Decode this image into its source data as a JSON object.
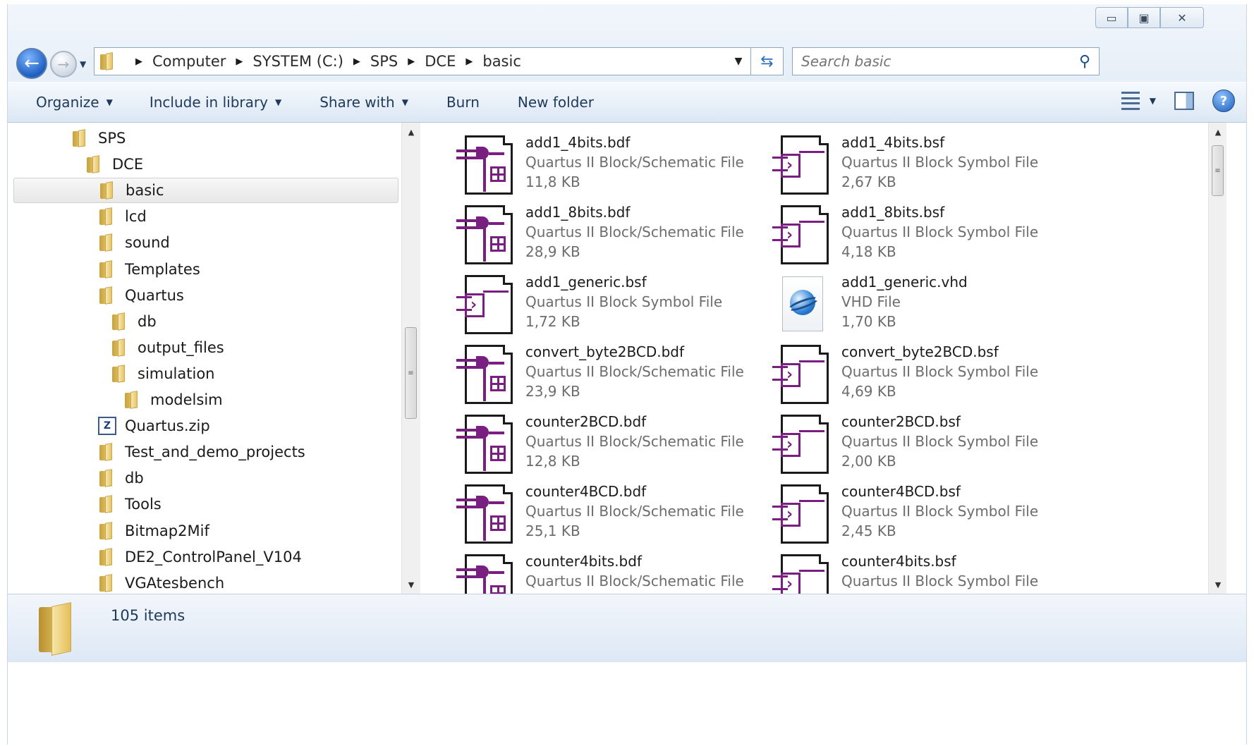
{
  "window": {
    "caption_buttons": [
      "minimize",
      "maximize",
      "close"
    ]
  },
  "address": {
    "crumbs": [
      "Computer",
      "SYSTEM (C:)",
      "SPS",
      "DCE",
      "basic"
    ]
  },
  "search": {
    "placeholder": "Search basic"
  },
  "toolbar": {
    "organize": "Organize",
    "include_in_library": "Include in library",
    "share_with": "Share with",
    "burn": "Burn",
    "new_folder": "New folder"
  },
  "nav_tree": [
    {
      "label": "SPS",
      "icon": "folder-icon",
      "level": 0
    },
    {
      "label": "DCE",
      "icon": "folder-icon",
      "level": 1
    },
    {
      "label": "basic",
      "icon": "folder-icon",
      "level": 2,
      "selected": true
    },
    {
      "label": "lcd",
      "icon": "folder-icon",
      "level": 2
    },
    {
      "label": "sound",
      "icon": "folder-icon",
      "level": 2
    },
    {
      "label": "Templates",
      "icon": "folder-icon",
      "level": 2
    },
    {
      "label": "Quartus",
      "icon": "folder-icon",
      "level": 3
    },
    {
      "label": "db",
      "icon": "folder-icon",
      "level": 4
    },
    {
      "label": "output_files",
      "icon": "folder-icon",
      "level": 4
    },
    {
      "label": "simulation",
      "icon": "folder-icon",
      "level": 4
    },
    {
      "label": "modelsim",
      "icon": "folder-icon",
      "level": 5
    },
    {
      "label": "Quartus.zip",
      "icon": "zip-icon",
      "level": 3
    },
    {
      "label": "Test_and_demo_projects",
      "icon": "folder-icon",
      "level": 2
    },
    {
      "label": "db",
      "icon": "folder-icon",
      "level": 3
    },
    {
      "label": "Tools",
      "icon": "folder-icon",
      "level": 2
    },
    {
      "label": "Bitmap2Mif",
      "icon": "folder-icon",
      "level": 3
    },
    {
      "label": "DE2_ControlPanel_V104",
      "icon": "folder-icon",
      "level": 3
    },
    {
      "label": "VGAtesbench",
      "icon": "folder-icon",
      "level": 3
    }
  ],
  "files": [
    {
      "name": "add1_4bits.bdf",
      "type": "Quartus II Block/Schematic File",
      "size": "11,8 KB",
      "icon": "bdf-icon"
    },
    {
      "name": "add1_4bits.bsf",
      "type": "Quartus II Block Symbol File",
      "size": "2,67 KB",
      "icon": "bsf-icon"
    },
    {
      "name": "add1_8bits.bdf",
      "type": "Quartus II Block/Schematic File",
      "size": "28,9 KB",
      "icon": "bdf-icon"
    },
    {
      "name": "add1_8bits.bsf",
      "type": "Quartus II Block Symbol File",
      "size": "4,18 KB",
      "icon": "bsf-icon"
    },
    {
      "name": "add1_generic.bsf",
      "type": "Quartus II Block Symbol File",
      "size": "1,72 KB",
      "icon": "bsf-icon"
    },
    {
      "name": "add1_generic.vhd",
      "type": "VHD File",
      "size": "1,70 KB",
      "icon": "vhd-icon"
    },
    {
      "name": "convert_byte2BCD.bdf",
      "type": "Quartus II Block/Schematic File",
      "size": "23,9 KB",
      "icon": "bdf-icon"
    },
    {
      "name": "convert_byte2BCD.bsf",
      "type": "Quartus II Block Symbol File",
      "size": "4,69 KB",
      "icon": "bsf-icon"
    },
    {
      "name": "counter2BCD.bdf",
      "type": "Quartus II Block/Schematic File",
      "size": "12,8 KB",
      "icon": "bdf-icon"
    },
    {
      "name": "counter2BCD.bsf",
      "type": "Quartus II Block Symbol File",
      "size": "2,00 KB",
      "icon": "bsf-icon"
    },
    {
      "name": "counter4BCD.bdf",
      "type": "Quartus II Block/Schematic File",
      "size": "25,1 KB",
      "icon": "bdf-icon"
    },
    {
      "name": "counter4BCD.bsf",
      "type": "Quartus II Block Symbol File",
      "size": "2,45 KB",
      "icon": "bsf-icon"
    },
    {
      "name": "counter4bits.bdf",
      "type": "Quartus II Block/Schematic File",
      "size": "",
      "icon": "bdf-icon"
    },
    {
      "name": "counter4bits.bsf",
      "type": "Quartus II Block Symbol File",
      "size": "",
      "icon": "bsf-icon"
    }
  ],
  "status": {
    "item_count": "105 items"
  },
  "colors": {
    "accent": "#7a1f82",
    "toolbar_text": "#1e395b"
  }
}
